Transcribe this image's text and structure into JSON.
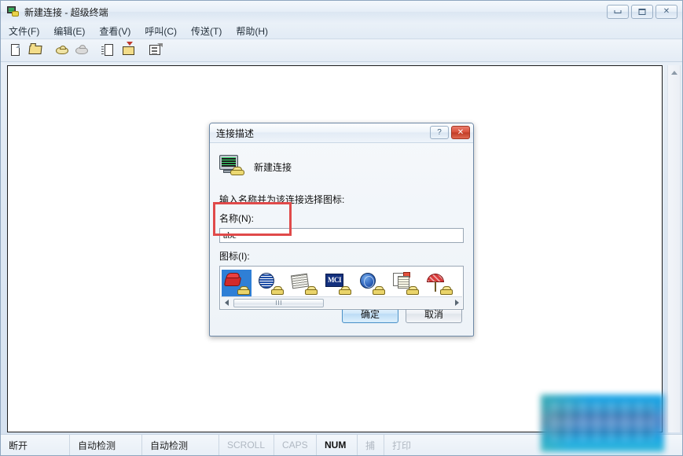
{
  "window": {
    "title": "新建连接 - 超级终端",
    "icon": "hyperterminal-icon",
    "buttons": {
      "minimize": "",
      "maximize": "",
      "close": "✕"
    }
  },
  "menu": {
    "items": [
      {
        "label": "文件(F)",
        "name": "menu-file"
      },
      {
        "label": "编辑(E)",
        "name": "menu-edit"
      },
      {
        "label": "查看(V)",
        "name": "menu-view"
      },
      {
        "label": "呼叫(C)",
        "name": "menu-call"
      },
      {
        "label": "传送(T)",
        "name": "menu-transfer"
      },
      {
        "label": "帮助(H)",
        "name": "menu-help"
      }
    ]
  },
  "toolbar": {
    "buttons": [
      {
        "icon": "new-document-icon"
      },
      {
        "icon": "open-folder-icon"
      },
      {
        "icon": "call-phone-icon"
      },
      {
        "icon": "disconnect-phone-icon"
      },
      {
        "icon": "send-file-icon"
      },
      {
        "icon": "receive-file-icon"
      },
      {
        "icon": "properties-icon"
      }
    ]
  },
  "terminal": {
    "content": ""
  },
  "statusbar": {
    "cells": [
      {
        "text": "断开",
        "state": "normal",
        "name": "status-connection"
      },
      {
        "text": "自动检测",
        "state": "normal",
        "name": "status-autodetect-1"
      },
      {
        "text": "自动检测",
        "state": "normal",
        "name": "status-autodetect-2"
      },
      {
        "text": "SCROLL",
        "state": "dim",
        "name": "status-scroll"
      },
      {
        "text": "CAPS",
        "state": "dim",
        "name": "status-caps"
      },
      {
        "text": "NUM",
        "state": "strong",
        "name": "status-num"
      },
      {
        "text": "捕",
        "state": "dim",
        "name": "status-capture"
      },
      {
        "text": "打印",
        "state": "dim",
        "name": "status-print"
      }
    ]
  },
  "dialog": {
    "title": "连接描述",
    "help_button": "?",
    "close_button": "✕",
    "connection_name_heading": "新建连接",
    "prompt": "输入名称并为该连接选择图标:",
    "name_label": "名称(N):",
    "name_value": "abc",
    "name_placeholder": "",
    "icon_label": "图标(I):",
    "icons": [
      {
        "name": "red-phone-icon",
        "art": "art-redphone",
        "selected": true
      },
      {
        "name": "striped-globe-icon",
        "art": "art-globe",
        "selected": false
      },
      {
        "name": "newspaper-icon",
        "art": "art-news",
        "selected": false
      },
      {
        "name": "mci-logo-icon",
        "art": "art-mci",
        "selected": false,
        "text": "MCI"
      },
      {
        "name": "blue-globe-icon",
        "art": "art-bglobe",
        "selected": false
      },
      {
        "name": "documents-icon",
        "art": "art-docs",
        "selected": false
      },
      {
        "name": "umbrella-icon",
        "art": "art-umb",
        "selected": false
      }
    ],
    "ok_label": "确定",
    "cancel_label": "取消"
  },
  "annotation": {
    "type": "red-rectangle-highlight",
    "target": "name-field"
  },
  "colors": {
    "accent": "#2f7fd6",
    "annotation": "#e04a4a",
    "close_button": "#d9503a",
    "window_bg": "#dee8f3",
    "terminal_bg": "#ffffff"
  }
}
